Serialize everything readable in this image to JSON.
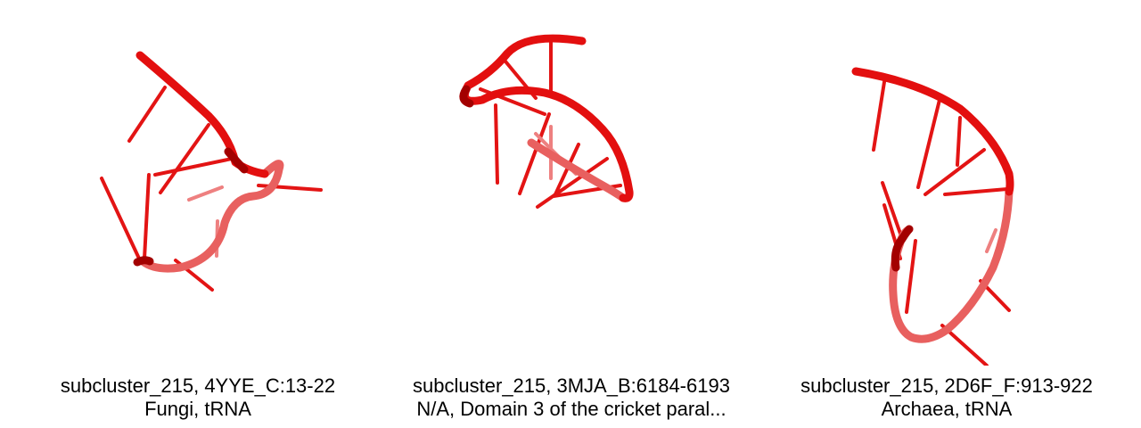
{
  "colors": {
    "backbone": "#e30f0f",
    "backbone_dark": "#a30000",
    "backbone_far": "#e8605f",
    "base": "#e31414",
    "background": "#ffffff",
    "caption_text": "#000000"
  },
  "panels": [
    {
      "caption_line1": "subcluster_215, 4YYE_C:13-22",
      "caption_line2": "Fungi, tRNA"
    },
    {
      "caption_line1": "subcluster_215, 3MJA_B:6184-6193",
      "caption_line2": "N/A, Domain 3 of the cricket paral..."
    },
    {
      "caption_line1": "subcluster_215, 2D6F_F:913-922",
      "caption_line2": "Archaea, tRNA"
    }
  ]
}
